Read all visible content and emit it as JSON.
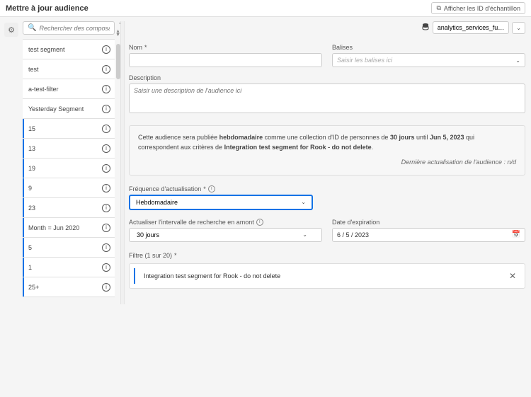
{
  "topbar": {
    "title": "Mettre à jour audience",
    "sample_btn": "Afficher les ID d'échantillon"
  },
  "sidebar": {
    "search_placeholder": "Rechercher des composants",
    "items": [
      {
        "label": "test segment"
      },
      {
        "label": "test"
      },
      {
        "label": "a-test-filter"
      },
      {
        "label": "Yesterday Segment"
      },
      {
        "label": "15"
      },
      {
        "label": "13"
      },
      {
        "label": "19"
      },
      {
        "label": "9"
      },
      {
        "label": "23"
      },
      {
        "label": "Month = Jun 2020"
      },
      {
        "label": "5"
      },
      {
        "label": "1"
      },
      {
        "label": "25+"
      }
    ]
  },
  "datasource": {
    "selected": "analytics_services_fu…"
  },
  "fields": {
    "name_label": "Nom",
    "tags_label": "Balises",
    "tags_placeholder": "Saisir les balises ici",
    "desc_label": "Description",
    "desc_placeholder": "Saisir une description de l'audience ici"
  },
  "summary": {
    "t1": "Cette audience sera publiée ",
    "b1": "hebdomadaire",
    "t2": " comme une collection d'ID de personnes de ",
    "b2": "30 jours",
    "t3": " until ",
    "b3": "Jun 5, 2023",
    "t4": " qui correspondent aux critères de ",
    "b4": "Integration test segment for Rook - do not delete",
    "t5": ".",
    "last_update": "Dernière actualisation de l'audience : n/d"
  },
  "frequency": {
    "label": "Fréquence d'actualisation",
    "value": "Hebdomadaire"
  },
  "lookback": {
    "label": "Actualiser l'intervalle de recherche en amont",
    "value": "30 jours"
  },
  "expiry": {
    "label": "Date d'expiration",
    "value": "6 /   5 / 2023"
  },
  "filter": {
    "label": "Filtre (1 sur 20)",
    "item": "Integration test segment for Rook - do not delete"
  }
}
